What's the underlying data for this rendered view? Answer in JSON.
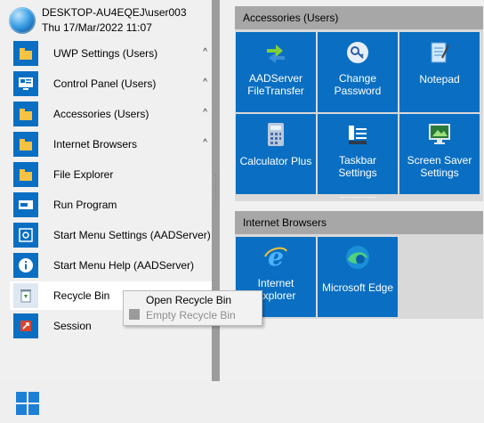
{
  "user": {
    "name": "DESKTOP-AU4EQEJ\\user003",
    "datetime": "Thu 17/Mar/2022 11:07"
  },
  "menu": {
    "items": [
      {
        "label": "UWP Settings (Users)",
        "icon": "folder-icon",
        "chevron": "^"
      },
      {
        "label": "Control Panel (Users)",
        "icon": "control-panel-icon",
        "chevron": "^"
      },
      {
        "label": "Accessories (Users)",
        "icon": "folder-icon",
        "chevron": "^"
      },
      {
        "label": "Internet Browsers",
        "icon": "folder-icon",
        "chevron": "^"
      },
      {
        "label": "File Explorer",
        "icon": "file-explorer-icon"
      },
      {
        "label": "Run Program",
        "icon": "run-icon"
      },
      {
        "label": "Start Menu Settings (AADServer)",
        "icon": "settings-icon"
      },
      {
        "label": "Start Menu Help (AADServer)",
        "icon": "info-icon"
      },
      {
        "label": "Recycle Bin",
        "icon": "recycle-bin-icon",
        "highlighted": true
      },
      {
        "label": "Session",
        "icon": "session-icon"
      }
    ]
  },
  "groups": [
    {
      "title": "Accessories (Users)",
      "tiles": [
        {
          "label": "AADServer FileTransfer",
          "icon": "file-transfer-icon"
        },
        {
          "label": "Change Password",
          "icon": "key-icon"
        },
        {
          "label": "Notepad",
          "icon": "notepad-icon"
        },
        {
          "label": "Calculator Plus",
          "icon": "calculator-icon"
        },
        {
          "label": "Taskbar Settings",
          "icon": "taskbar-settings-icon"
        },
        {
          "label": "Screen Saver Settings",
          "icon": "screen-saver-icon"
        }
      ]
    },
    {
      "title": "Internet Browsers",
      "tiles": [
        {
          "label": "Internet Explorer",
          "icon": "internet-explorer-icon"
        },
        {
          "label": "Microsoft Edge",
          "icon": "edge-icon"
        }
      ]
    }
  ],
  "context_menu": {
    "items": [
      {
        "label": "Open Recycle Bin",
        "enabled": true
      },
      {
        "label": "Empty Recycle Bin",
        "enabled": false
      }
    ]
  },
  "taskbar": {
    "start_icon": "windows-logo-icon"
  },
  "colors": {
    "tile_blue": "#0a6fc2",
    "group_header": "#a7a7a7",
    "highlight": "#ffffff"
  }
}
